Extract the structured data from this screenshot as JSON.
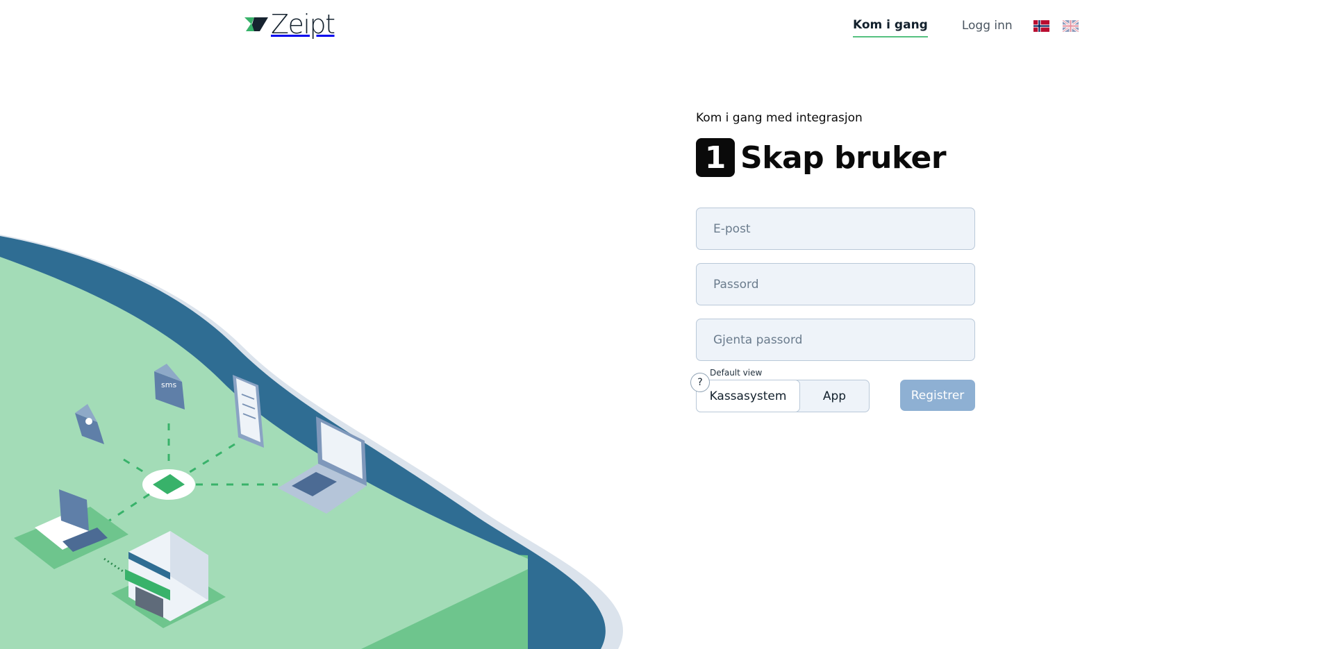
{
  "header": {
    "logo_text": "Zeipt",
    "nav": [
      {
        "label": "Kom i gang",
        "active": true
      },
      {
        "label": "Logg inn",
        "active": false
      }
    ],
    "languages": [
      "norwegian-flag-icon",
      "uk-flag-icon"
    ]
  },
  "form": {
    "subtitle": "Kom i gang med integrasjon",
    "step_number": "1",
    "title": "Skap bruker",
    "email_placeholder": "E-post",
    "password_placeholder": "Passord",
    "repeat_password_placeholder": "Gjenta passord",
    "help_icon": "?",
    "default_view_label": "Default view",
    "view_options": [
      "Kassasystem",
      "App"
    ],
    "selected_view": "Kassasystem",
    "register_label": "Registrer"
  },
  "colors": {
    "brand_green": "#55c17f",
    "sea_blue": "#2f6d93",
    "land_green": "#a3dcb7",
    "button_disabled": "#8eb0d3",
    "field_bg": "#eef3f9"
  }
}
